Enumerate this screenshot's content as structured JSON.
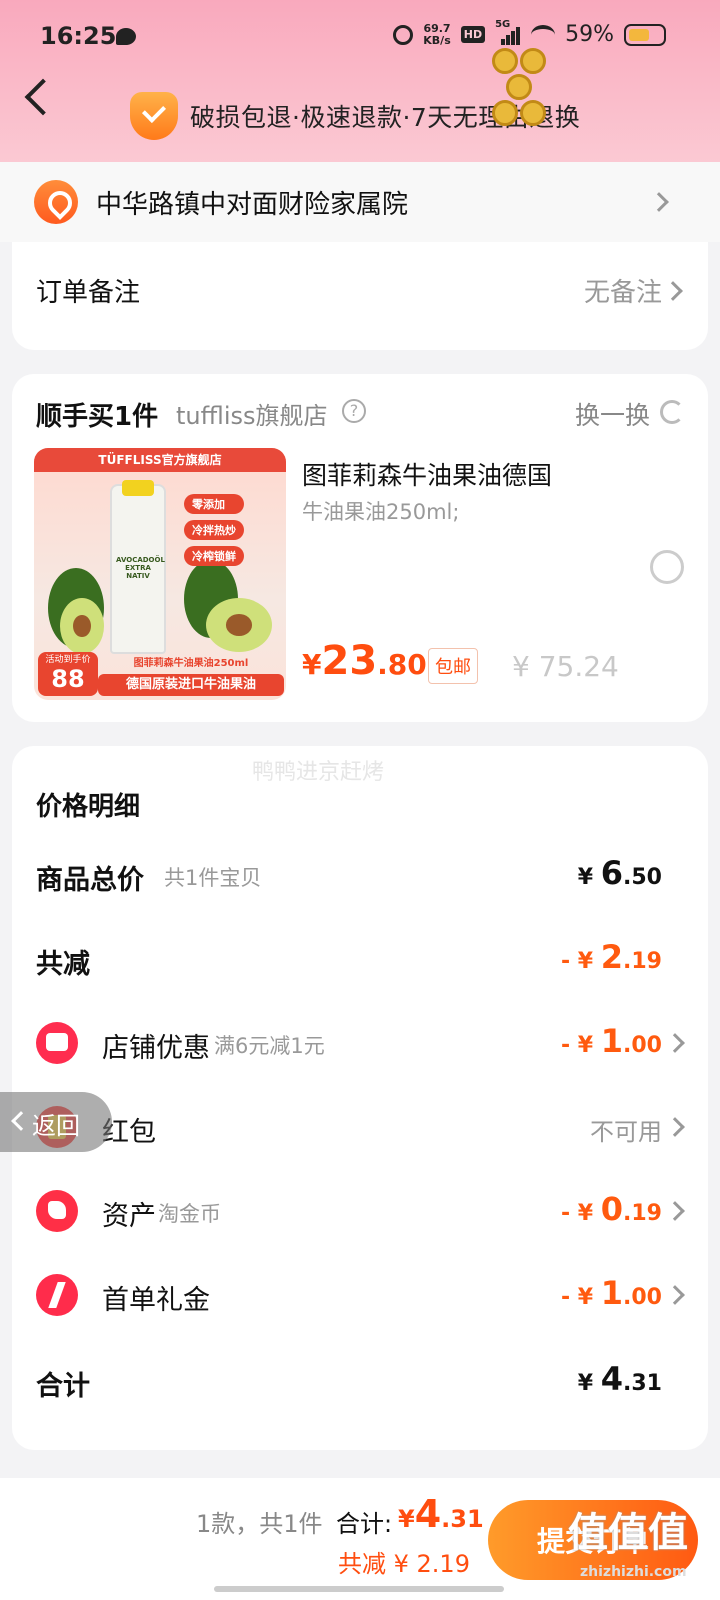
{
  "status_bar": {
    "time": "16:25",
    "net_speed_value": "69.7",
    "net_speed_unit": "KB/s",
    "hd_label": "HD",
    "signal_label": "5G",
    "battery_percent": "59%"
  },
  "header": {
    "guarantee_text": "破损包退·极速退款·7天无理由退换"
  },
  "address": {
    "text": "中华路镇中对面财险家属院"
  },
  "note": {
    "label": "订单备注",
    "value": "无备注"
  },
  "addon": {
    "title": "顺手买1件",
    "store": "tuffliss旗舰店",
    "help_glyph": "?",
    "swap_label": "换一换",
    "product": {
      "name": "图菲莉森牛油果油德国",
      "spec": "牛油果油250ml;",
      "price_symbol": "¥",
      "price_int": "23",
      "price_dec": ".80",
      "ship_tag": "包邮",
      "original_price": "¥ 75.24",
      "image": {
        "banner": "TÜFFLISS官方旗舰店",
        "bottle_label": "AVOCADOÖL EXTRA NATIV",
        "tags": [
          "零添加",
          "冷拌热炒",
          "冷榨锁鲜"
        ],
        "price_label": "活动到手价",
        "price_value": "88",
        "sub_caption": "图菲莉森牛油果油250ml",
        "caption": "德国原装进口牛油果油"
      }
    }
  },
  "detail": {
    "watermark": "鸭鸭进京赶烤",
    "title": "价格明细",
    "rows": [
      {
        "label": "商品总价",
        "sub": "共1件宝贝",
        "sym": "¥ ",
        "int": "6",
        "dec": ".50"
      },
      {
        "label": "共减",
        "sym": "- ¥ ",
        "int": "2",
        "dec": ".19"
      },
      {
        "label": "店铺优惠",
        "sub": "满6元减1元",
        "sym": "- ¥ ",
        "int": "1",
        "dec": ".00"
      },
      {
        "label": "红包",
        "value": "不可用"
      },
      {
        "label": "资产",
        "sub": "淘金币",
        "sym": "- ¥ ",
        "int": "0",
        "dec": ".19"
      },
      {
        "label": "首单礼金",
        "sym": "- ¥ ",
        "int": "1",
        "dec": ".00"
      },
      {
        "label": "合计",
        "sym": "¥ ",
        "int": "4",
        "dec": ".31"
      }
    ]
  },
  "floating_back": {
    "label": "返回"
  },
  "bottom_bar": {
    "count_text": "1款，共1件",
    "total_label": "合计:",
    "total_symbol": "¥",
    "total_int": "4",
    "total_dec": ".31",
    "saved_text": "共减 ¥ 2.19",
    "submit_label": "提交订单",
    "watermark": "值值值",
    "watermark_url": "zhizhizhi.com"
  },
  "colors": {
    "accent": "#ff5a0f",
    "header_pink": "#fbc9d3"
  }
}
